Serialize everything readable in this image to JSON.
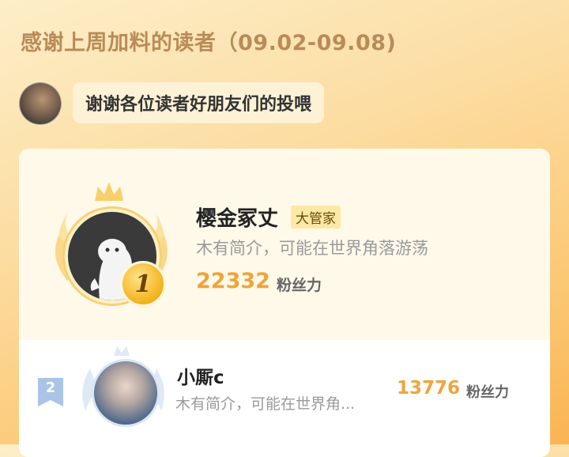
{
  "header": {
    "title": "感谢上周加料的读者（09.02-09.08)"
  },
  "author": {
    "message": "谢谢各位读者好朋友们的投喂"
  },
  "ranking": {
    "first": {
      "rank": "1",
      "name": "樱金冢丈",
      "badge": "大管家",
      "bio": "木有简介，可能在世界角落游荡",
      "score": "22332",
      "unit": "粉丝力"
    },
    "second": {
      "rank": "2",
      "name": "小厮c",
      "bio": "木有简介，可能在世界角...",
      "score": "13776",
      "unit": "粉丝力"
    }
  },
  "colors": {
    "accent": "#f0a43a",
    "gold": "#f3b21c",
    "title": "#b98b58"
  }
}
